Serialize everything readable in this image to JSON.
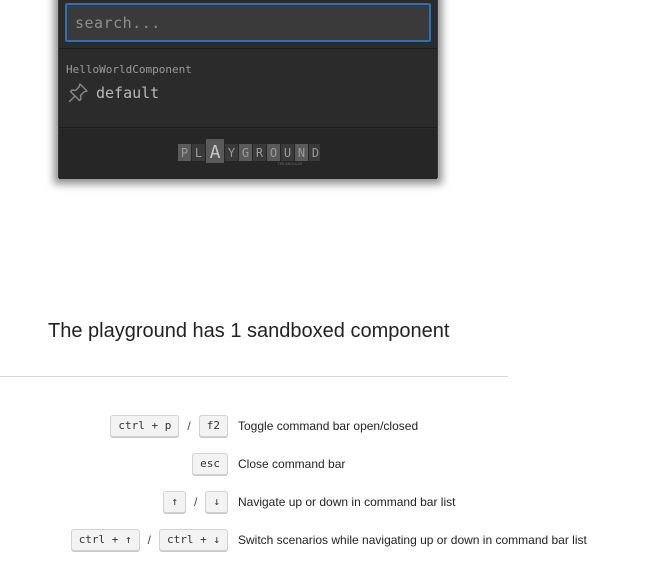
{
  "command_bar": {
    "search_placeholder": "search...",
    "component_name": "HelloWorldComponent",
    "scenario_label": "default",
    "logo_letters": [
      "P",
      "L",
      "A",
      "Y",
      "G",
      "R",
      "O",
      "U",
      "N",
      "D"
    ],
    "logo_tagline": "THE ANGULAR",
    "colors": {
      "panel": "#2b2b2b",
      "input_border": "#2d6fb8"
    }
  },
  "main": {
    "headline": "The playground has 1 sandboxed component"
  },
  "shortcuts": [
    {
      "keys": [
        "ctrl + p",
        "f2"
      ],
      "separator": "/",
      "description": "Toggle command bar open/closed"
    },
    {
      "keys": [
        "esc"
      ],
      "separator": "",
      "description": "Close command bar"
    },
    {
      "keys": [
        "↑",
        "↓"
      ],
      "separator": "/",
      "description": "Navigate up or down in command bar list"
    },
    {
      "keys": [
        "ctrl + ↑",
        "ctrl + ↓"
      ],
      "separator": "/",
      "description": "Switch scenarios while navigating up or down in command bar list"
    }
  ]
}
